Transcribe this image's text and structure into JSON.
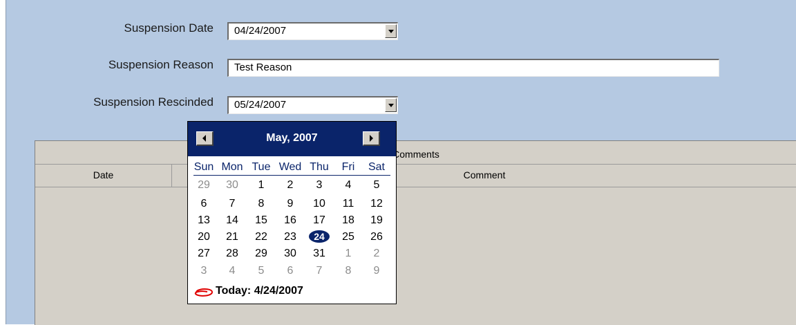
{
  "form": {
    "suspension_date_label": "Suspension Date",
    "suspension_date_value": "04/24/2007",
    "suspension_reason_label": "Suspension Reason",
    "suspension_reason_value": "Test Reason",
    "suspension_rescinded_label": "Suspension Rescinded",
    "suspension_rescinded_value": "05/24/2007"
  },
  "grid": {
    "group_header": "Comments",
    "columns": [
      "Date",
      "Comment"
    ]
  },
  "calendar": {
    "title": "May, 2007",
    "weekdays": [
      "Sun",
      "Mon",
      "Tue",
      "Wed",
      "Thu",
      "Fri",
      "Sat"
    ],
    "weeks": [
      [
        "29",
        "30",
        "1",
        "2",
        "3",
        "4",
        "5"
      ],
      [
        "6",
        "7",
        "8",
        "9",
        "10",
        "11",
        "12"
      ],
      [
        "13",
        "14",
        "15",
        "16",
        "17",
        "18",
        "19"
      ],
      [
        "20",
        "21",
        "22",
        "23",
        "24",
        "25",
        "26"
      ],
      [
        "27",
        "28",
        "29",
        "30",
        "31",
        "1",
        "2"
      ],
      [
        "3",
        "4",
        "5",
        "6",
        "7",
        "8",
        "9"
      ]
    ],
    "selected_day": "24",
    "today_text": "Today: 4/24/2007"
  },
  "colors": {
    "panel_bg": "#b5c9e2",
    "calendar_header": "#0a246a",
    "today_circle": "#e00000"
  }
}
